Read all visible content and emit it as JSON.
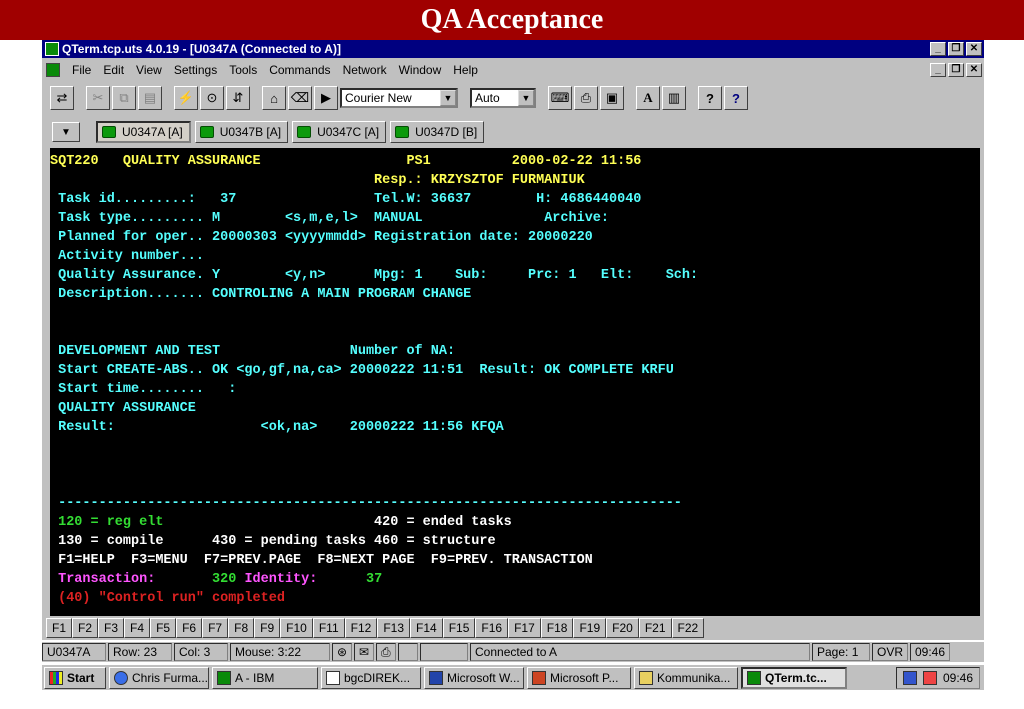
{
  "slide": {
    "title": "QA Acceptance"
  },
  "window": {
    "title": "QTerm.tcp.uts 4.0.19 - [U0347A (Connected to A)]",
    "buttons": {
      "minimize": "_",
      "restore": "❐",
      "close": "✕"
    }
  },
  "menu": [
    {
      "label": "File",
      "key": "F"
    },
    {
      "label": "Edit",
      "key": "E"
    },
    {
      "label": "View",
      "key": "V"
    },
    {
      "label": "Settings",
      "key": "S"
    },
    {
      "label": "Tools",
      "key": "T"
    },
    {
      "label": "Commands",
      "key": "C"
    },
    {
      "label": "Network",
      "key": "N"
    },
    {
      "label": "Window",
      "key": "W"
    },
    {
      "label": "Help",
      "key": "H"
    }
  ],
  "toolbar": {
    "font_combo": "Courier New",
    "size_combo": "Auto",
    "font_a_label": "A",
    "help_label": "?",
    "context_help_label": "?"
  },
  "sessions": [
    {
      "label": "U0347A [A]"
    },
    {
      "label": "U0347B [A]"
    },
    {
      "label": "U0347C [A]"
    },
    {
      "label": "U0347D [B]"
    }
  ],
  "terminal": {
    "l01": "SQT220   QUALITY ASSURANCE                  PS1          2000-02-22 11:56",
    "l02": "                                        Resp.: KRZYSZTOF FURMANIUK",
    "l03": " Task id.........:   37                 Tel.W: 36637        H: 4686440040",
    "l04a": " Task type......... M        <s,m,e,l>  MANUAL",
    "l04b": "               Archive:",
    "l05": " Planned for oper.. 20000303 <yyyymmdd> Registration date: 20000220",
    "l06": " Activity number...",
    "l07": " Quality Assurance. Y        <y,n>      Mpg: 1    Sub:     Prc: 1   Elt:    Sch:",
    "l08": " Description....... CONTROLING A MAIN PROGRAM CHANGE",
    "l11": " DEVELOPMENT AND TEST                Number of NA:",
    "l12": " Start CREATE-ABS.. OK <go,gf,na,ca> 20000222 11:51  Result: OK COMPLETE KRFU",
    "l13": " Start time........   :",
    "l14": " QUALITY ASSURANCE",
    "l15": " Result:                  <ok,na>    20000222 11:56 KFQA",
    "l19": " -----------------------------------------------------------------------------",
    "l20a": " 120 = reg elt",
    "l20b": "                          420 = ended tasks",
    "l21": " 130 = compile      430 = pending tasks 460 = structure",
    "l22": " F1=HELP  F3=MENU  F7=PREV.PAGE  F8=NEXT PAGE  F9=PREV. TRANSACTION",
    "l23a": " Transaction:",
    "l23b": "       320",
    "l23c": " Identity:",
    "l23d": "      37",
    "l24": " (40) \"Control run\" completed"
  },
  "fkeys": [
    "F1",
    "F2",
    "F3",
    "F4",
    "F5",
    "F6",
    "F7",
    "F8",
    "F9",
    "F10",
    "F11",
    "F12",
    "F13",
    "F14",
    "F15",
    "F16",
    "F17",
    "F18",
    "F19",
    "F20",
    "F21",
    "F22"
  ],
  "status": {
    "session": "U0347A",
    "row": "Row: 23",
    "col": "Col: 3",
    "mouse": "Mouse:  3:22",
    "connection": "Connected to A",
    "page": "Page: 1",
    "ovr": "OVR",
    "time": "09:46"
  },
  "taskbar": {
    "start": "Start",
    "items": [
      "Chris Furma...",
      "A - IBM",
      "bgcDIREK...",
      "Microsoft W...",
      "Microsoft P...",
      "Kommunika...",
      "QTerm.tc..."
    ],
    "clock": "09:46"
  }
}
